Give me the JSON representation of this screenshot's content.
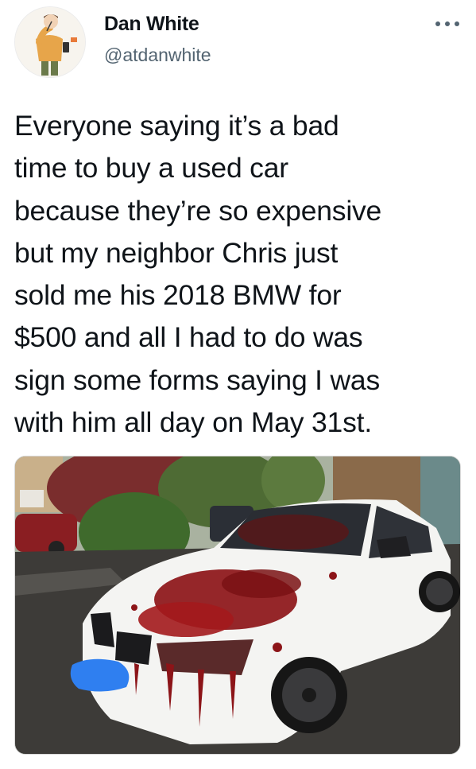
{
  "tweet": {
    "author": {
      "display_name": "Dan White",
      "handle": "@atdanwhite",
      "avatar_icon": "cartoon-person-avatar"
    },
    "more_icon": "more-horizontal-icon",
    "text_lines": [
      "Everyone saying it’s a bad",
      "time to buy a used car",
      "because they’re so expensive",
      "but my neighbor Chris just",
      "sold me his 2018 BMW for",
      "$500 and all I had to do was",
      "sign some forms saying I was",
      "with him all day on May 31st."
    ],
    "media": {
      "description_icon": "white-bmw-splattered-with-red-photo"
    }
  },
  "colors": {
    "text": "#0f1419",
    "secondary_text": "#536471",
    "background": "#ffffff"
  }
}
